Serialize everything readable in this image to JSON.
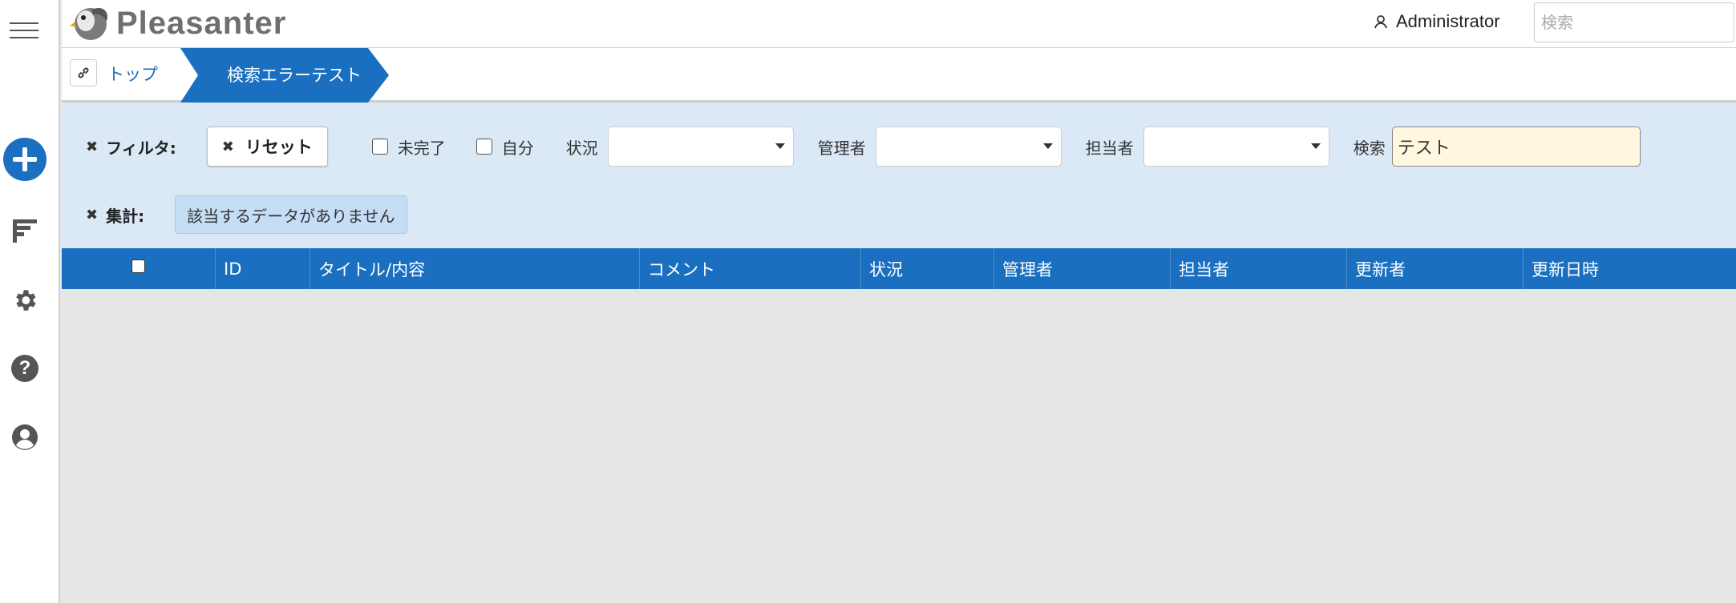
{
  "app": {
    "logo_text": "Pleasanter",
    "user_name": "Administrator",
    "search_placeholder": "検索"
  },
  "breadcrumb": {
    "home": "トップ",
    "current": "検索エラーテスト"
  },
  "filters": {
    "filter_label": "フィルタ:",
    "reset_label": "リセット",
    "incomplete_label": "未完了",
    "own_label": "自分",
    "status_label": "状況",
    "manager_label": "管理者",
    "owner_label": "担当者",
    "search_label": "検索",
    "search_value": "テスト"
  },
  "aggregation": {
    "label": "集計:",
    "message": "該当するデータがありません"
  },
  "grid": {
    "columns": [
      "ID",
      "タイトル/内容",
      "コメント",
      "状況",
      "管理者",
      "担当者",
      "更新者",
      "更新日時"
    ]
  },
  "colors": {
    "accent": "#1a6fc0",
    "filter_bg": "#dbe8f6",
    "search_bg": "#fff8df"
  }
}
